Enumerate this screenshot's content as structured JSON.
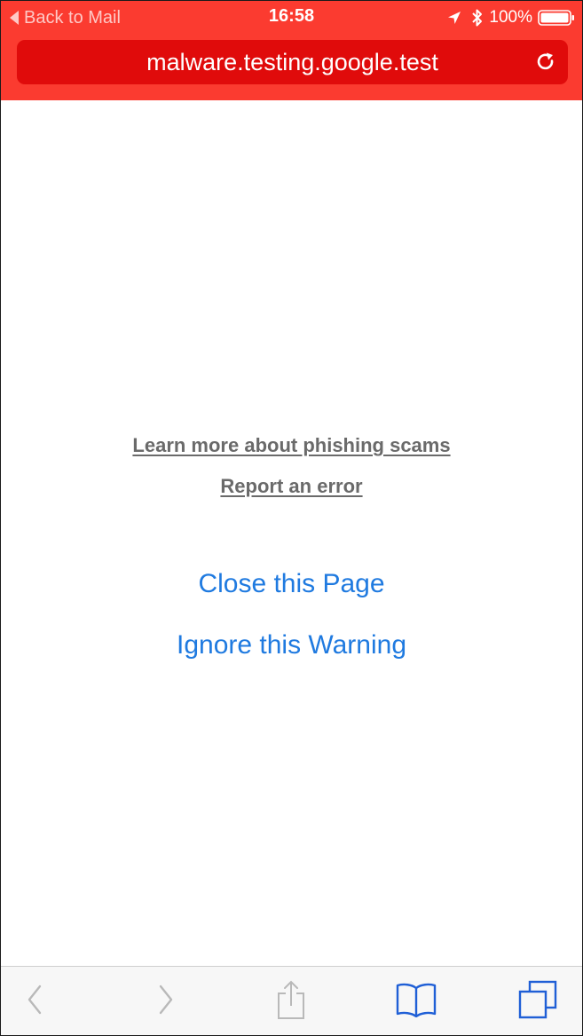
{
  "status_bar": {
    "back_label": "Back to Mail",
    "time": "16:58",
    "battery": "100%"
  },
  "url_bar": {
    "domain": "malware.testing.google.test"
  },
  "content": {
    "learn_more": "Learn more about phishing scams",
    "report_error": "Report an error",
    "close_page": "Close this Page",
    "ignore_warning": "Ignore this Warning"
  },
  "colors": {
    "header": "#fb3b30",
    "url_bar": "#e00b0b",
    "link_gray": "#6a6a6a",
    "action_blue": "#1f7ae0",
    "toolbar": "#f7f7f7"
  },
  "toolbar": {
    "icons": [
      "back-icon",
      "forward-icon",
      "share-icon",
      "bookmarks-icon",
      "tabs-icon"
    ]
  }
}
